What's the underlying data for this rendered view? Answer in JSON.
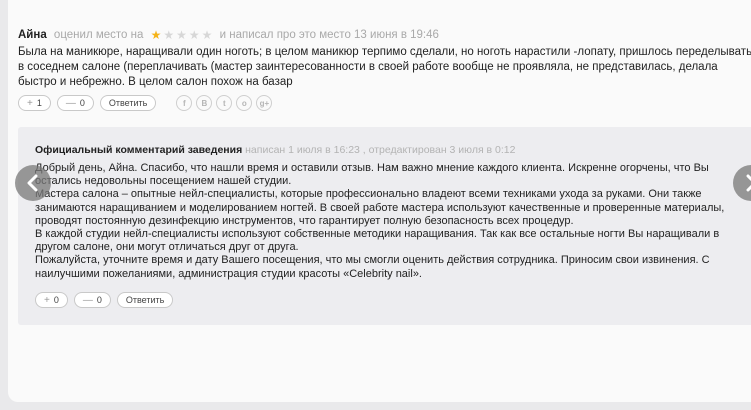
{
  "review": {
    "author": "Айна",
    "rated_text": "оценил место на",
    "rating": 1,
    "max_rating": 5,
    "wrote_text": "и написал про это место 13 июня в 19:46",
    "body": "Была на маникюре, наращивали один ноготь; в целом маникюр терпимо сделали, но ноготь нарастили -лопату, пришлось переделывать в соседнем салоне (переплачивать (мастер заинтересованности в своей работе вообще не проявляла, не представилась, делала быстро и небрежно. В целом салон похож на базар",
    "likes": "1",
    "dislikes": "0",
    "reply_label": "Ответить",
    "share_icons": [
      {
        "name": "facebook-icon",
        "glyph": "f"
      },
      {
        "name": "vk-icon",
        "glyph": "В"
      },
      {
        "name": "twitter-icon",
        "glyph": "t"
      },
      {
        "name": "odnoklassniki-icon",
        "glyph": "о"
      },
      {
        "name": "google-plus-icon",
        "glyph": "g+"
      }
    ]
  },
  "official_reply": {
    "title": "Официальный комментарий заведения",
    "meta": "написан 1 июля в 16:23 , отредактирован 3 июля в 0:12",
    "paragraphs": [
      "Добрый день, Айна. Спасибо, что нашли время и оставили отзыв. Нам важно мнение каждого клиента. Искренне огорчены, что Вы остались недовольны посещением нашей студии.",
      "Мастера салона – опытные нейл-специалисты, которые профессионально владеют всеми техниками ухода за руками. Они также занимаются наращиванием и моделированием ногтей. В своей работе мастера используют качественные и проверенные материалы, проводят постоянную дезинфекцию инструментов, что гарантирует полную безопасность всех процедур.",
      "В каждой студии нейл-специалисты используют собственные методики наращивания. Так как все остальные ногти Вы наращивали в другом салоне, они могут отличаться друг от друга.",
      "Пожалуйста, уточните время и дату Вашего посещения, что мы смогли оценить действия сотрудника. Приносим свои извинения. С наилучшими пожеланиями, администрация студии красоты «Celebrity nail»."
    ],
    "likes": "0",
    "dislikes": "0",
    "reply_label": "Ответить"
  },
  "colors": {
    "star_active": "#f5b318",
    "star_inactive": "#d7d7d7"
  }
}
